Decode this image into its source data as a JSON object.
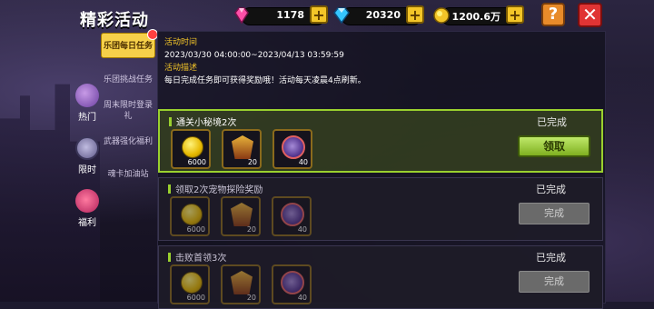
{
  "header": {
    "title": "精彩活动"
  },
  "resources": [
    {
      "name": "pink-gem",
      "value": "1178",
      "color": "#ff4fa8"
    },
    {
      "name": "blue-diamond",
      "value": "20320",
      "color": "#35c6ff"
    },
    {
      "name": "gold-coin",
      "value": "1200.6万",
      "color": "#f3c528"
    }
  ],
  "toolbar": {
    "help_label": "?",
    "close_label": "✕"
  },
  "nav": [
    {
      "label": "热门",
      "icon": "hot-icon"
    },
    {
      "label": "限时",
      "icon": "timer-icon"
    },
    {
      "label": "福利",
      "icon": "gift-icon"
    }
  ],
  "subtabs": [
    {
      "label": "乐团每日任务",
      "active": true
    },
    {
      "label": "乐团挑战任务"
    },
    {
      "label": "周末限时登录礼"
    },
    {
      "label": "武器强化福利"
    },
    {
      "label": "魂卡加油站"
    }
  ],
  "info": {
    "time_label": "活动时间",
    "time_value": "2023/03/30 04:00:00~2023/04/13 03:59:59",
    "desc_label": "活动描述",
    "desc_value": "每日完成任务即可获得奖励哦！活动每天凌晨4点刷新。"
  },
  "tasks": [
    {
      "title": "通关小秘境2次",
      "status": "已完成",
      "button": "领取",
      "rewards": [
        {
          "icon": "gold-coin-icon",
          "count": "6000"
        },
        {
          "icon": "crest-icon",
          "count": "20"
        },
        {
          "icon": "pet-ball-icon",
          "count": "40"
        }
      ]
    },
    {
      "title": "领取2次宠物探险奖励",
      "status": "已完成",
      "button": "完成",
      "rewards": [
        {
          "icon": "gold-coin-icon",
          "count": "6000"
        },
        {
          "icon": "crest-icon",
          "count": "20"
        },
        {
          "icon": "pet-ball-icon",
          "count": "40"
        }
      ]
    },
    {
      "title": "击败首领3次",
      "status": "已完成",
      "button": "完成",
      "rewards": [
        {
          "icon": "gold-coin-icon",
          "count": "6000"
        },
        {
          "icon": "crest-icon",
          "count": "20"
        },
        {
          "icon": "pet-ball-icon",
          "count": "40"
        }
      ]
    }
  ]
}
